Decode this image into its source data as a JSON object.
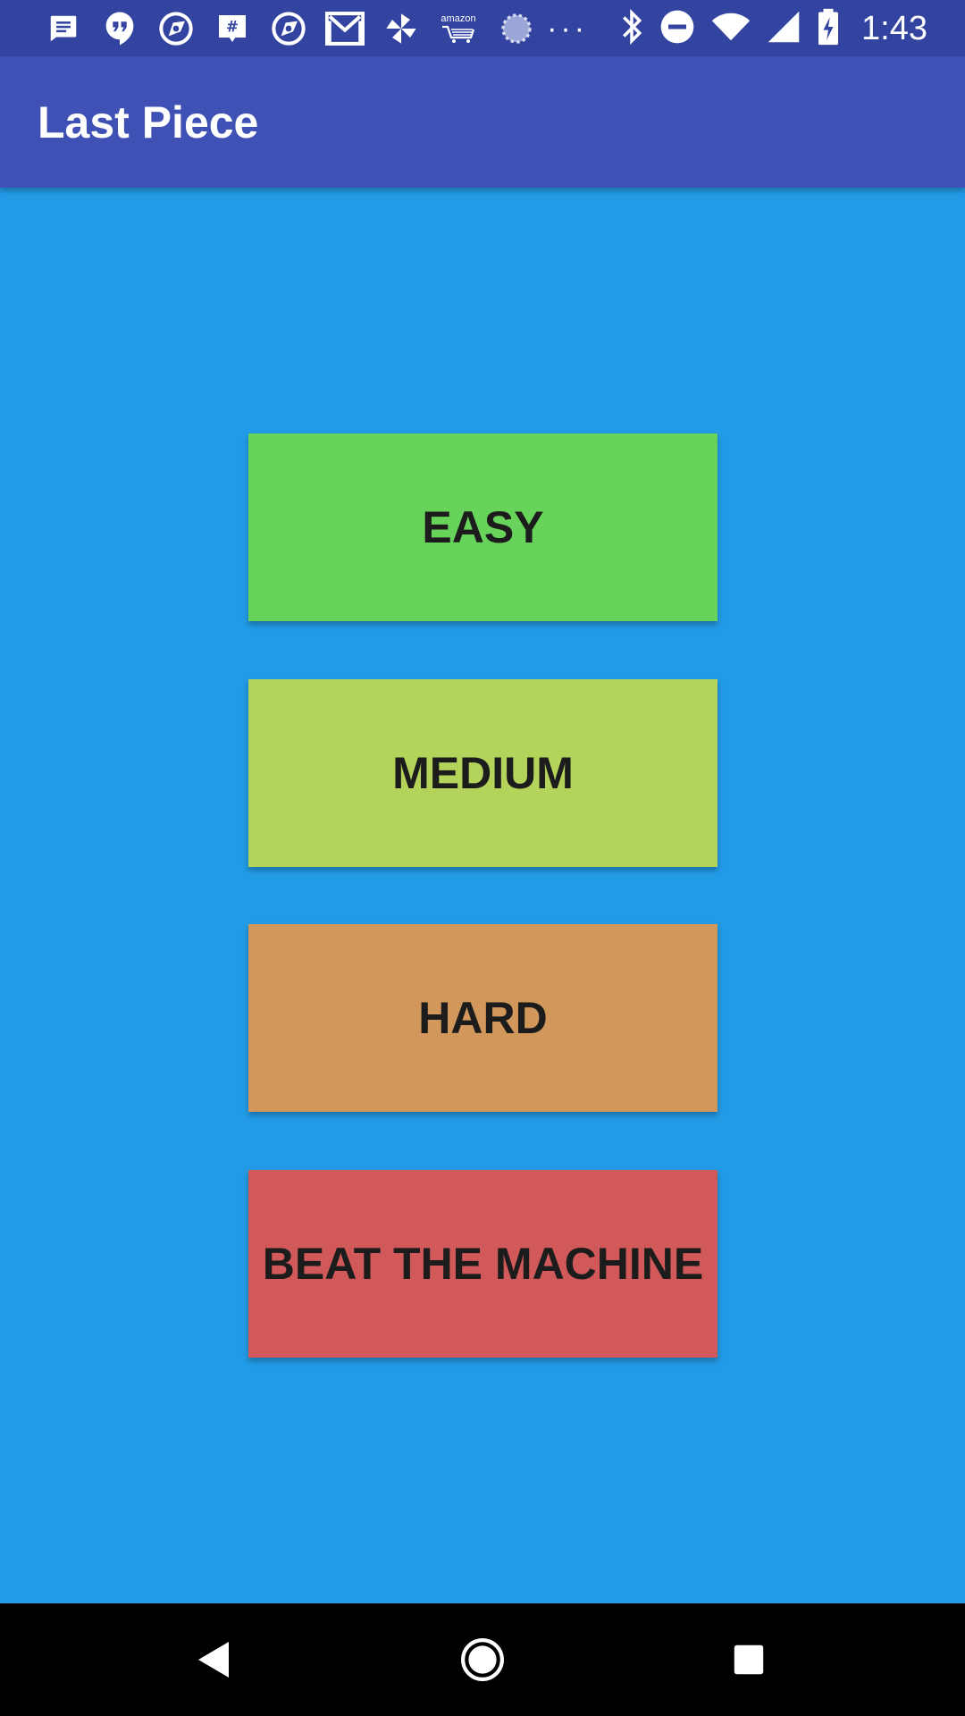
{
  "status_bar": {
    "time": "1:43",
    "dots": "···",
    "notification_icons": [
      "messages-icon",
      "hangouts-icon",
      "app-icon",
      "slack-icon",
      "app-icon",
      "gmail-icon",
      "pinwheel-icon",
      "amazon-icon",
      "loading-icon"
    ],
    "system_icons": [
      "bluetooth-icon",
      "do-not-disturb-icon",
      "wifi-icon",
      "cell-signal-icon",
      "battery-charging-icon"
    ],
    "amazon_label": "amazon"
  },
  "app_bar": {
    "title": "Last Piece"
  },
  "levels": {
    "easy": {
      "label": "EASY",
      "color": "#68d35a"
    },
    "medium": {
      "label": "MEDIUM",
      "color": "#b3d35a"
    },
    "hard": {
      "label": "HARD",
      "color": "#d2975a"
    },
    "beat": {
      "label": "BEAT THE MACHINE",
      "color": "#d2595a"
    }
  },
  "colors": {
    "status_bar": "#3243a0",
    "app_bar": "#3f51b5",
    "background": "#229be6",
    "nav_bar": "#000000"
  },
  "nav": {
    "back": "back-icon",
    "home": "home-icon",
    "recents": "recents-icon"
  }
}
